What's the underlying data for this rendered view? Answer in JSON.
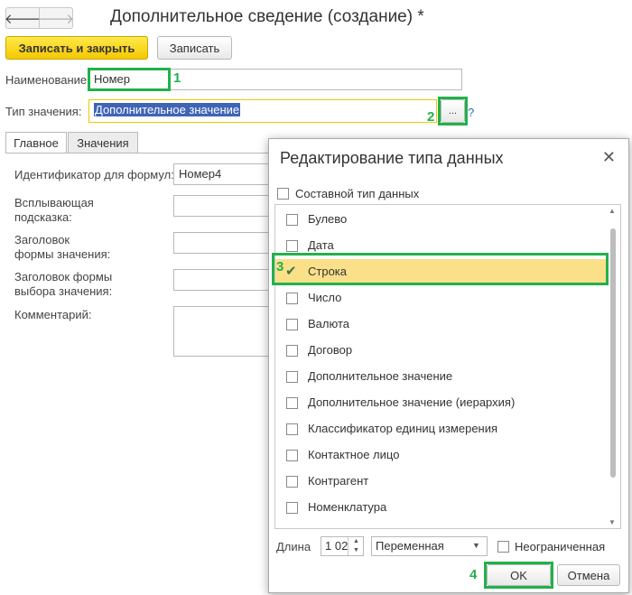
{
  "window": {
    "title": "Дополнительное сведение (создание) *",
    "nav_back": "🡐",
    "nav_forward": "🡒"
  },
  "toolbar": {
    "save_close_label": "Записать и закрыть",
    "save_label": "Записать"
  },
  "form": {
    "name_label": "Наименование:",
    "name_value": "Номер",
    "type_label": "Тип значения:",
    "type_value": "Дополнительное значение",
    "type_select_button": "...",
    "help_label": "?"
  },
  "tabs": [
    {
      "label": "Главное",
      "active": true
    },
    {
      "label": "Значения",
      "active": false
    }
  ],
  "main_tab": {
    "formula_id_label": "Идентификатор для формул:",
    "formula_id_value": "Номер4",
    "tooltip_label_1": "Всплывающая",
    "tooltip_label_2": "подсказка:",
    "value_title_label_1": "Заголовок",
    "value_title_label_2": "формы значения:",
    "choice_title_label_1": "Заголовок формы",
    "choice_title_label_2": "выбора значения:",
    "comment_label": "Комментарий:"
  },
  "annotations": [
    "1",
    "2",
    "3",
    "4"
  ],
  "dialog": {
    "title": "Редактирование типа данных",
    "close": "✕",
    "composite_label": "Составной тип данных",
    "types": [
      {
        "label": "Булево",
        "checked": false
      },
      {
        "label": "Дата",
        "checked": false
      },
      {
        "label": "Строка",
        "checked": true
      },
      {
        "label": "Число",
        "checked": false
      },
      {
        "label": "Валюта",
        "checked": false
      },
      {
        "label": "Договор",
        "checked": false
      },
      {
        "label": "Дополнительное значение",
        "checked": false
      },
      {
        "label": "Дополнительное значение (иерархия)",
        "checked": false
      },
      {
        "label": "Классификатор единиц измерения",
        "checked": false
      },
      {
        "label": "Контактное лицо",
        "checked": false
      },
      {
        "label": "Контрагент",
        "checked": false
      },
      {
        "label": "Номенклатура",
        "checked": false
      }
    ],
    "length_label": "Длина",
    "length_value": "1 02",
    "length_mode": "Переменная",
    "unlimited_label": "Неограниченная",
    "ok_label": "OK",
    "cancel_label": "Отмена"
  },
  "colors": {
    "accent_yellow": "#f5c800",
    "annotation_green": "#22b14c",
    "selection_blue": "#3f64b6",
    "selected_row": "#fbe08a"
  }
}
